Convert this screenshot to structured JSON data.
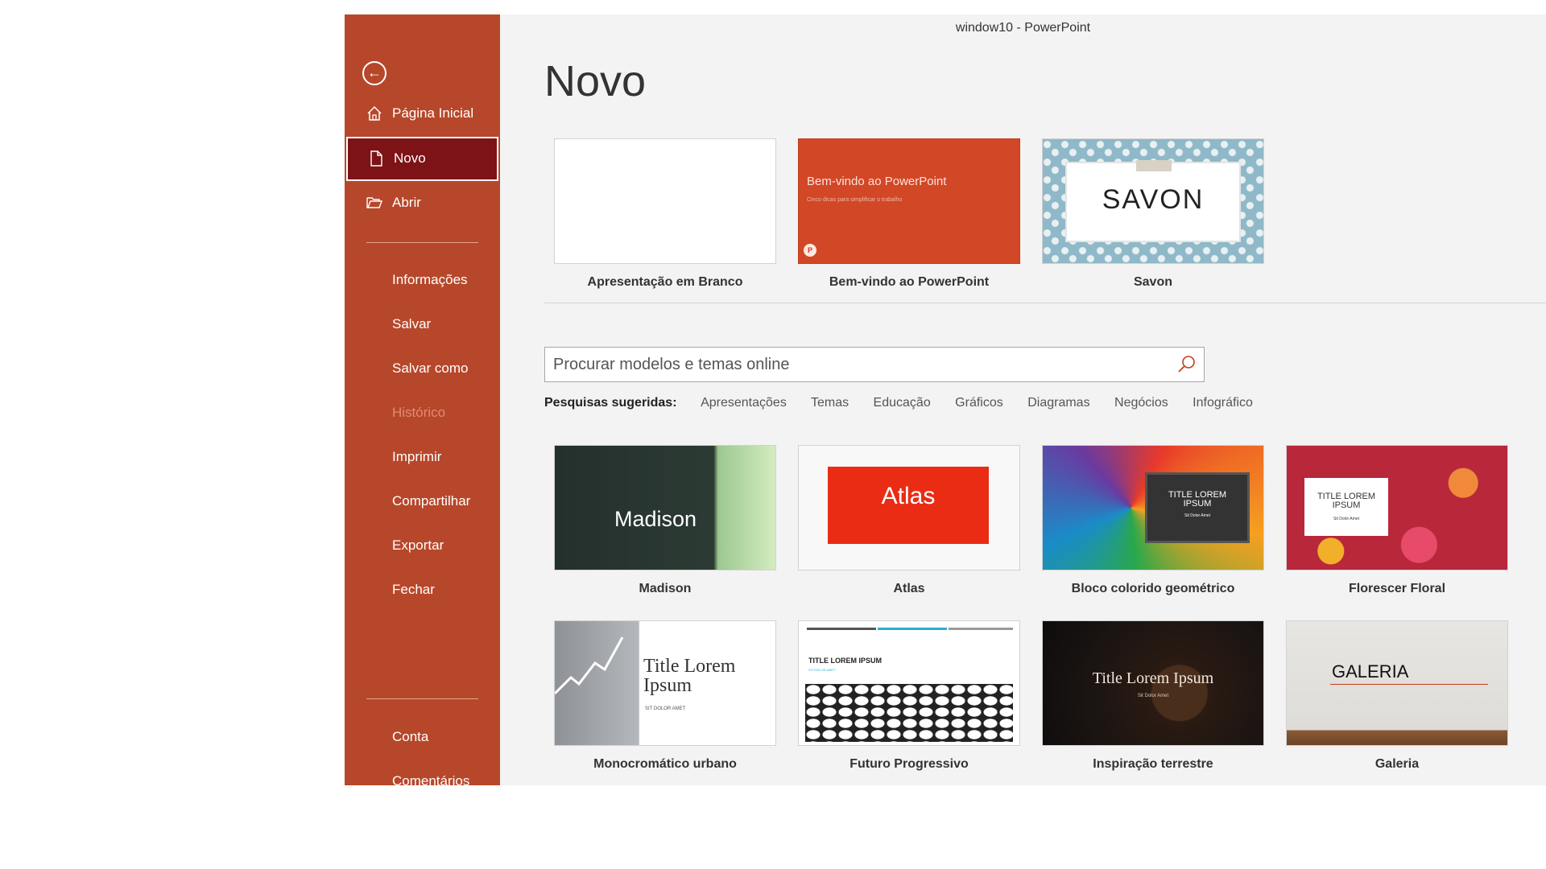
{
  "window": {
    "title": "window10  -  PowerPoint"
  },
  "sidebar": {
    "back_icon": "back-arrow-icon",
    "items": [
      {
        "label": "Página Inicial",
        "icon": "home-icon"
      },
      {
        "label": "Novo",
        "icon": "new-document-icon",
        "active": true
      },
      {
        "label": "Abrir",
        "icon": "open-folder-icon"
      },
      {
        "label": "Informações"
      },
      {
        "label": "Salvar"
      },
      {
        "label": "Salvar como"
      },
      {
        "label": "Histórico",
        "disabled": true
      },
      {
        "label": "Imprimir"
      },
      {
        "label": "Compartilhar"
      },
      {
        "label": "Exportar"
      },
      {
        "label": "Fechar"
      },
      {
        "label": "Conta"
      },
      {
        "label": "Comentários"
      }
    ]
  },
  "main": {
    "title": "Novo",
    "featured": [
      {
        "name": "Apresentação em Branco"
      },
      {
        "name": "Bem-vindo ao PowerPoint",
        "thumb_title": "Bem-vindo ao PowerPoint",
        "thumb_subtitle": "Cinco dicas para simplificar o trabalho",
        "thumb_logo": "P"
      },
      {
        "name": "Savon",
        "thumb_title": "SAVON"
      }
    ],
    "search": {
      "placeholder": "Procurar modelos e temas online",
      "value": "",
      "icon": "search-icon"
    },
    "suggested": {
      "label": "Pesquisas sugeridas:",
      "items": [
        "Apresentações",
        "Temas",
        "Educação",
        "Gráficos",
        "Diagramas",
        "Negócios",
        "Infográfico"
      ]
    },
    "templates": [
      {
        "name": "Madison",
        "thumb_title": "Madison"
      },
      {
        "name": "Atlas",
        "thumb_title": "Atlas"
      },
      {
        "name": "Bloco colorido geométrico",
        "thumb_title_1": "TITLE LOREM",
        "thumb_title_2": "IPSUM",
        "thumb_sub": "Sit Dolor Amet"
      },
      {
        "name": "Florescer Floral",
        "thumb_title_1": "TITLE LOREM",
        "thumb_title_2": "IPSUM",
        "thumb_sub": "Sit Dolor Amet"
      },
      {
        "name": "Monocromático urbano",
        "thumb_title_1": "Title Lorem",
        "thumb_title_2": "Ipsum",
        "thumb_sub": "SIT DOLOR AMET"
      },
      {
        "name": "Futuro Progressivo",
        "thumb_title": "TITLE LOREM IPSUM",
        "thumb_sub": "SIT DOLOR AMET"
      },
      {
        "name": "Inspiração terrestre",
        "thumb_title": "Title Lorem Ipsum",
        "thumb_sub": "Sit Dolor Amet"
      },
      {
        "name": "Galeria",
        "thumb_title": "GALERIA"
      }
    ]
  },
  "colors": {
    "sidebar": "#b7472a",
    "sidebar_active": "#7d1317",
    "accent": "#c43e1c",
    "background": "#f3f3f3"
  }
}
